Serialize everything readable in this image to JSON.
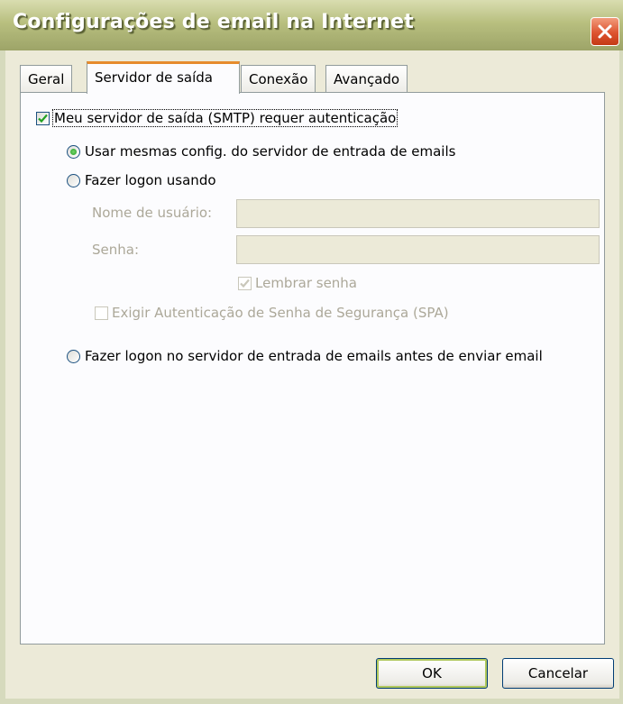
{
  "window": {
    "title": "Configurações de email na Internet"
  },
  "tabs": [
    {
      "label": "Geral",
      "active": false
    },
    {
      "label": "Servidor de saída",
      "active": true
    },
    {
      "label": "Conexão",
      "active": false
    },
    {
      "label": "Avançado",
      "active": false
    }
  ],
  "outgoing": {
    "requires_auth_label": "Meu servidor de saída (SMTP) requer autenticação",
    "requires_auth_checked": true,
    "radio_same_settings_label": "Usar mesmas config. do servidor de entrada de emails",
    "radio_logon_using_label": "Fazer logon usando",
    "username_label": "Nome de usuário:",
    "username_value": "",
    "password_label": "Senha:",
    "password_value": "",
    "remember_password_label": "Lembrar senha",
    "remember_password_checked": true,
    "spa_label": "Exigir Autenticação de Senha de Segurança (SPA)",
    "spa_checked": false,
    "radio_logon_incoming_label": "Fazer logon no servidor de entrada de emails antes de enviar email",
    "selected_option": "same_settings"
  },
  "buttons": {
    "ok_label": "OK",
    "cancel_label": "Cancelar"
  },
  "colors": {
    "title_bar": "#b8bf7f",
    "active_tab_accent": "#e68b2c",
    "radio_selected": "#21a121",
    "close_button": "#dd5430"
  }
}
